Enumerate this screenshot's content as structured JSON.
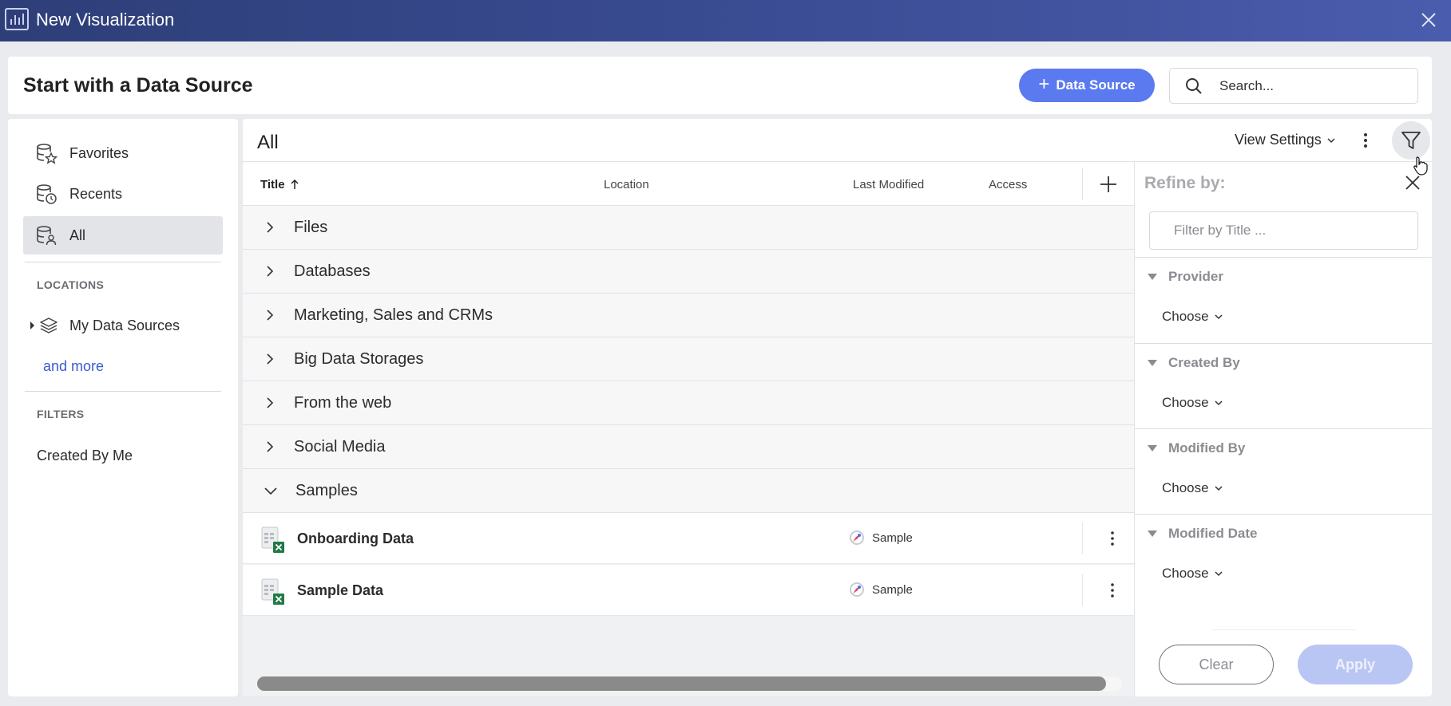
{
  "window": {
    "title": "New Visualization"
  },
  "header": {
    "heading": "Start with a Data Source",
    "add_button": "Data Source",
    "search_placeholder": "Search..."
  },
  "sidebar": {
    "items": [
      {
        "label": "Favorites"
      },
      {
        "label": "Recents"
      },
      {
        "label": "All"
      }
    ],
    "active": "All",
    "locations_heading": "LOCATIONS",
    "locations": [
      {
        "label": "My Data Sources"
      }
    ],
    "more_link": "and more",
    "filters_heading": "FILTERS",
    "filters": [
      {
        "label": "Created By Me"
      }
    ]
  },
  "main": {
    "title": "All",
    "view_settings": "View Settings",
    "columns": {
      "title": "Title",
      "location": "Location",
      "last_modified": "Last Modified",
      "access": "Access"
    },
    "groups": [
      {
        "label": "Files",
        "expanded": false
      },
      {
        "label": "Databases",
        "expanded": false
      },
      {
        "label": "Marketing, Sales and CRMs",
        "expanded": false
      },
      {
        "label": "Big Data Storages",
        "expanded": false
      },
      {
        "label": "From the web",
        "expanded": false
      },
      {
        "label": "Social Media",
        "expanded": false
      },
      {
        "label": "Samples",
        "expanded": true
      }
    ],
    "items": [
      {
        "name": "Onboarding Data",
        "access": "Sample"
      },
      {
        "name": "Sample Data",
        "access": "Sample"
      }
    ]
  },
  "refine": {
    "title": "Refine by:",
    "filter_placeholder": "Filter by Title ...",
    "facets": [
      {
        "label": "Provider",
        "value": "Choose"
      },
      {
        "label": "Created By",
        "value": "Choose"
      },
      {
        "label": "Modified By",
        "value": "Choose"
      },
      {
        "label": "Modified Date",
        "value": "Choose"
      }
    ],
    "clear_label": "Clear",
    "apply_label": "Apply"
  },
  "colors": {
    "titlebar": "#2d3e78",
    "accent": "#5b7af0",
    "apply_disabled": "#b9c6f4",
    "link": "#3a5bd0"
  }
}
